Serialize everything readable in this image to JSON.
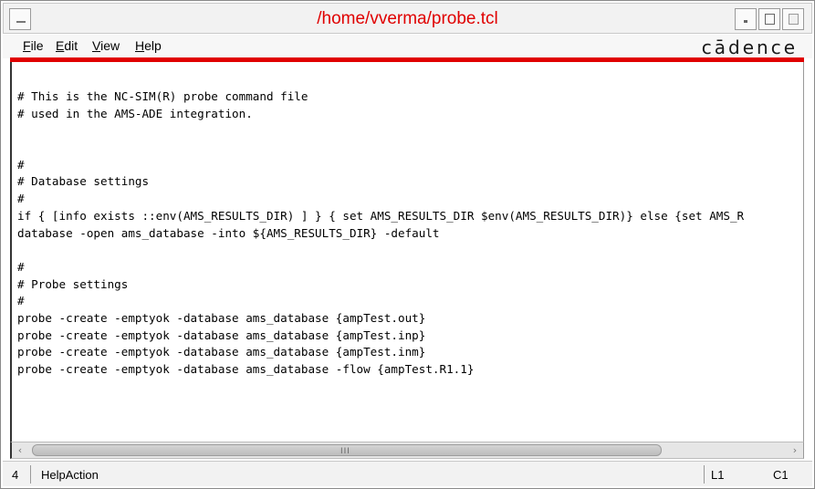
{
  "window": {
    "title": "/home/vverma/probe.tcl"
  },
  "menubar": {
    "items": [
      {
        "label": "File"
      },
      {
        "label": "Edit"
      },
      {
        "label": "View"
      },
      {
        "label": "Help"
      }
    ],
    "brand": "cādence"
  },
  "editor": {
    "lines": [
      "# This is the NC-SIM(R) probe command file",
      "# used in the AMS-ADE integration.",
      "",
      "",
      "#",
      "# Database settings",
      "#",
      "if { [info exists ::env(AMS_RESULTS_DIR) ] } { set AMS_RESULTS_DIR $env(AMS_RESULTS_DIR)} else {set AMS_R",
      "database -open ams_database -into ${AMS_RESULTS_DIR} -default",
      "",
      "#",
      "# Probe settings",
      "#",
      "probe -create -emptyok -database ams_database {ampTest.out}",
      "probe -create -emptyok -database ams_database {ampTest.inp}",
      "probe -create -emptyok -database ams_database {ampTest.inm}",
      "probe -create -emptyok -database ams_database -flow {ampTest.R1.1}"
    ]
  },
  "scrollbar": {
    "grip": "III"
  },
  "statusbar": {
    "number": "4",
    "message": "HelpAction",
    "line": "L1",
    "column": "C1"
  },
  "colors": {
    "title": "#e00000",
    "accent_line": "#e00000"
  }
}
